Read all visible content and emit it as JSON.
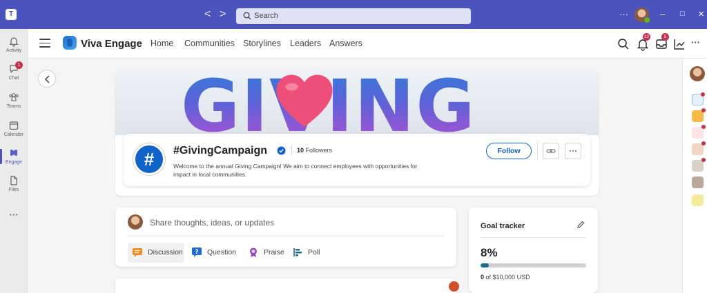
{
  "titlebar": {
    "search_placeholder": "Search",
    "back_glyph": "<",
    "forward_glyph": ">",
    "more_glyph": "···",
    "minimize_glyph": "–",
    "maximize_glyph": "□",
    "close_glyph": "✕"
  },
  "rail": {
    "items": [
      {
        "label": "Activity",
        "icon": "bell-icon"
      },
      {
        "label": "Chat",
        "icon": "chat-icon",
        "badge": "1"
      },
      {
        "label": "Teams",
        "icon": "teams-icon"
      },
      {
        "label": "Calender",
        "icon": "calendar-icon"
      },
      {
        "label": "Engage",
        "icon": "engage-icon",
        "active": true
      },
      {
        "label": "Files",
        "icon": "file-icon"
      }
    ],
    "more_glyph": "···"
  },
  "appbar": {
    "title": "Viva Engage",
    "nav": [
      "Home",
      "Communities",
      "Storylines",
      "Leaders",
      "Answers"
    ],
    "notifications_badge": "12",
    "inbox_badge": "5",
    "more_glyph": "···"
  },
  "community": {
    "banner_text": "GIVING",
    "avatar_glyph": "#",
    "name": "#GivingCampaign",
    "followers_count": "10",
    "followers_label": "Followers",
    "description": "Welcome to the annual Giving Campaign! We aim to connect employees with opportunities for impact in local communities.",
    "follow_label": "Follow"
  },
  "publisher": {
    "placeholder": "Share thoughts, ideas, or updates",
    "types": [
      "Discussion",
      "Question",
      "Praise",
      "Poll"
    ]
  },
  "goal": {
    "title": "Goal tracker",
    "percent_label": "8%",
    "progress": 0.08,
    "current": "0",
    "target_text": "of $10,000 USD"
  },
  "colors": {
    "brand": "#4b53bc",
    "accent": "#1063c9",
    "badge": "#c4314b"
  }
}
